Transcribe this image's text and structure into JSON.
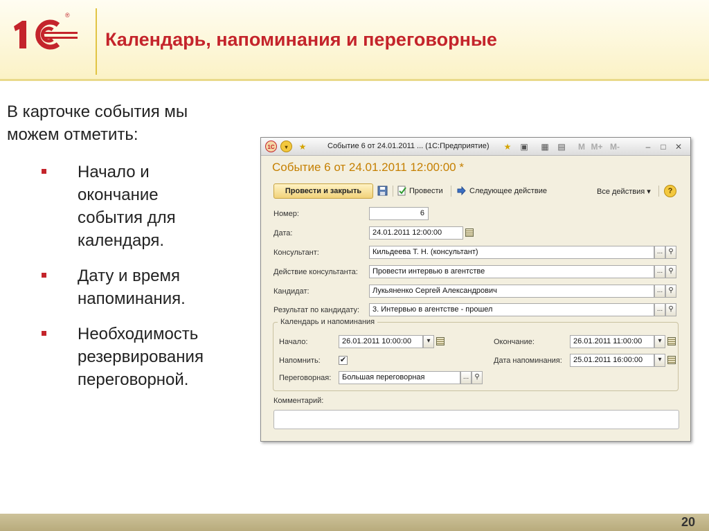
{
  "slide": {
    "logo_text": "1С",
    "logo_reg_mark": "®",
    "title": "Календарь, напоминания и переговорные",
    "intro_line1": "В карточке события мы",
    "intro_line2": "можем отметить:",
    "bullets": [
      {
        "lines": [
          "Начало и",
          "окончание",
          "события для",
          "календаря."
        ]
      },
      {
        "lines": [
          "Дату и время",
          "напоминания."
        ]
      },
      {
        "lines": [
          "Необходимость",
          "резервирования",
          "переговорной."
        ]
      }
    ],
    "page_number": "20"
  },
  "colors": {
    "brand_red": "#c4242b",
    "header_bg": "#fbf2c6",
    "form_title": "#c57f00",
    "footer_band": "#c3b78b"
  },
  "window": {
    "titlebar": {
      "title": "Событие 6 от 24.01.2011 ...  (1С:Предприятие)",
      "app_icon_label": "1С",
      "icons": [
        "app-icon",
        "menu-dropdown-icon",
        "favorite-star-icon",
        "add-favorite-icon",
        "bookmark-icon",
        "calculator-icon",
        "calendar-icon",
        "memory-m-button",
        "memory-mplus-button",
        "memory-mminus-button",
        "minimize-icon",
        "maximize-icon",
        "close-icon"
      ],
      "m_label": "M",
      "mplus_label": "M+",
      "mminus_label": "M-"
    },
    "form_title": "Событие 6 от 24.01.2011 12:00:00 *",
    "toolbar": {
      "post_close_label": "Провести и закрыть",
      "post_label": "Провести",
      "next_action_label": "Следующее действие",
      "all_actions_label": "Все действия ▾",
      "help_label": "?"
    },
    "fields": {
      "number_label": "Номер:",
      "number_value": "6",
      "date_label": "Дата:",
      "date_value": "24.01.2011 12:00:00",
      "consultant_label": "Консультант:",
      "consultant_value": "Кильдеева Т. Н. (консультант)",
      "consultant_action_label": "Действие консультанта:",
      "consultant_action_value": "Провести интервью в агентстве",
      "candidate_label": "Кандидат:",
      "candidate_value": "Лукьяненко Сергей Александрович",
      "candidate_result_label": "Результат по кандидату:",
      "candidate_result_value": "3. Интервью в агентстве - прошел",
      "choose_button": "...",
      "open_button": "🔍"
    },
    "calendar_group": {
      "legend": "Календарь и напоминания",
      "start_label": "Начало:",
      "start_value": "26.01.2011 10:00:00",
      "end_label": "Окончание:",
      "end_value": "26.01.2011 11:00:00",
      "remind_label": "Напомнить:",
      "remind_checked": "✔",
      "remind_date_label": "Дата напоминания:",
      "remind_date_value": "25.01.2011 16:00:00",
      "room_label": "Переговорная:",
      "room_value": "Большая переговорная",
      "dropdown_arrow": "▾"
    },
    "comment_label": "Комментарий:",
    "comment_value": ""
  }
}
